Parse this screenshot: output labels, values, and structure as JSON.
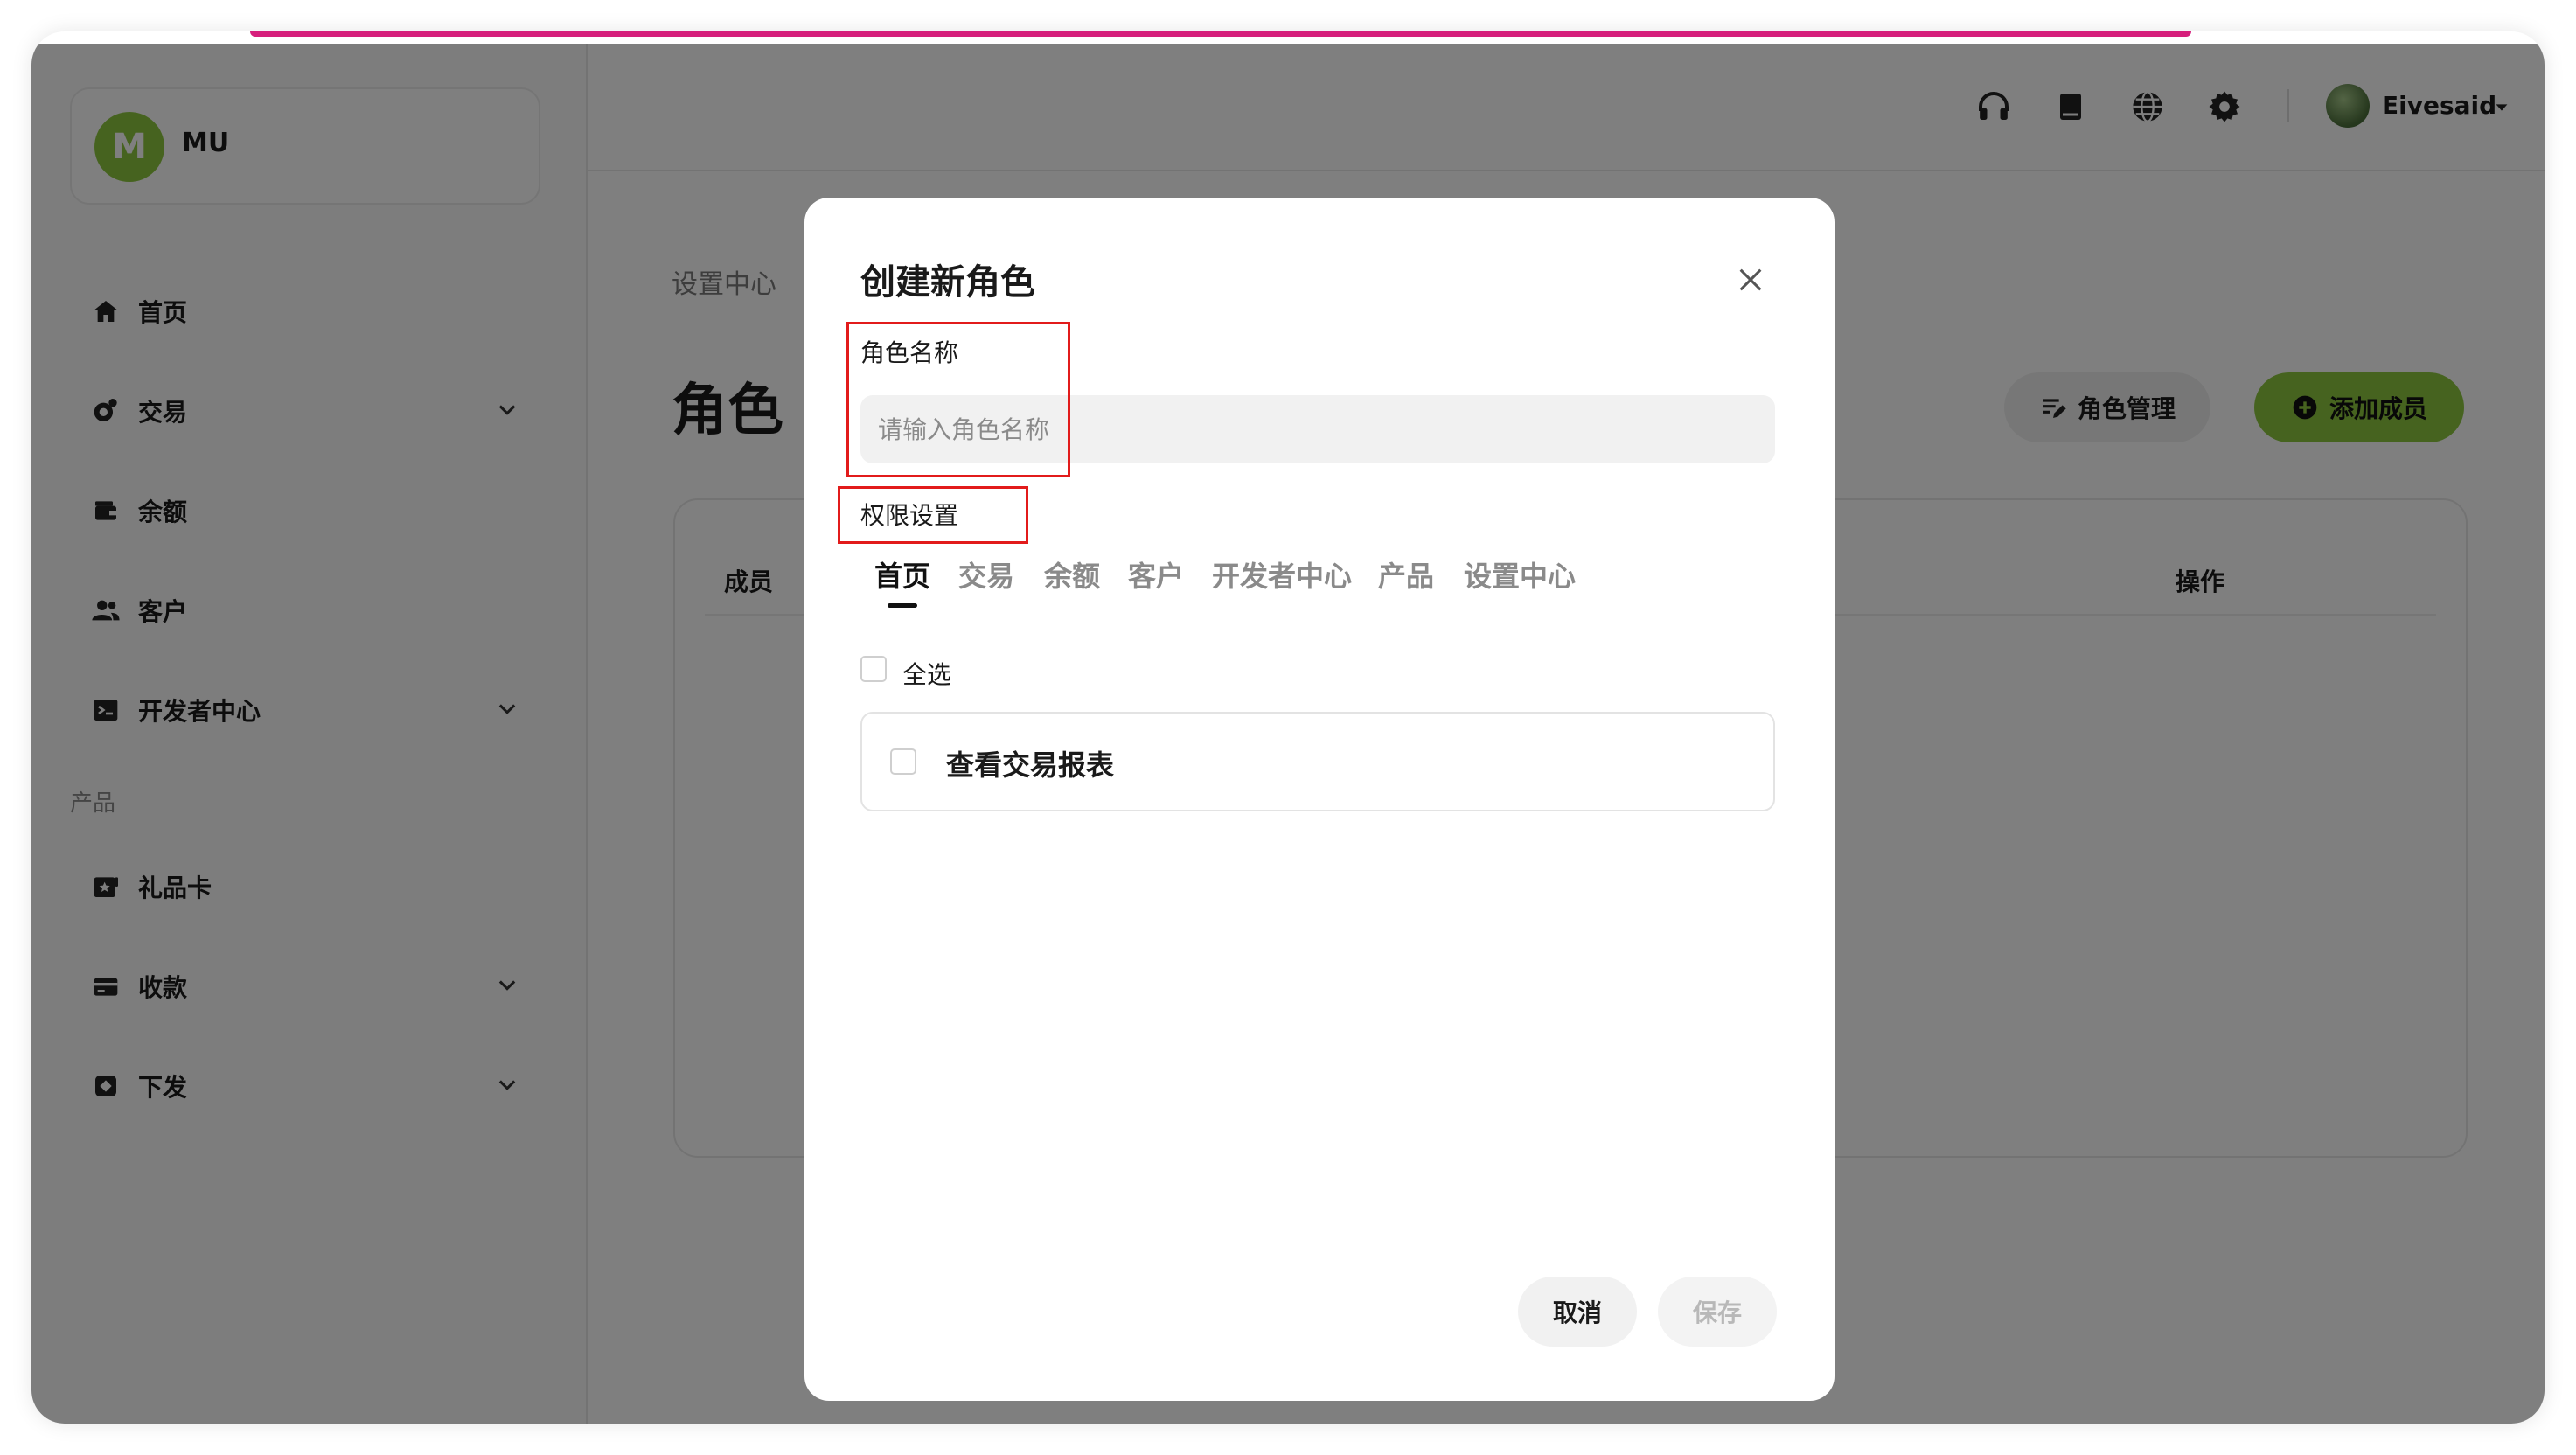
{
  "sidebar": {
    "org_initial": "M",
    "org_name": "MU",
    "items": [
      {
        "label": "首页"
      },
      {
        "label": "交易"
      },
      {
        "label": "余额"
      },
      {
        "label": "客户"
      },
      {
        "label": "开发者中心"
      },
      {
        "label": "礼品卡"
      },
      {
        "label": "收款"
      },
      {
        "label": "下发"
      }
    ],
    "section_products": "产品"
  },
  "header": {
    "user_name": "Eivesaid",
    "icons": [
      "headset-icon",
      "book-icon",
      "globe-icon",
      "gear-icon"
    ]
  },
  "page": {
    "breadcrumb": "设置中心",
    "title": "角色",
    "roles_button": "角色管理",
    "add_member_button": "添加成员",
    "table": {
      "col_member": "成员",
      "col_actions": "操作"
    }
  },
  "modal": {
    "title": "创建新角色",
    "role_name_label": "角色名称",
    "role_name_placeholder": "请输入角色名称",
    "role_name_value": "",
    "permissions_label": "权限设置",
    "tabs": [
      {
        "label": "首页"
      },
      {
        "label": "交易"
      },
      {
        "label": "余额"
      },
      {
        "label": "客户"
      },
      {
        "label": "开发者中心"
      },
      {
        "label": "产品"
      },
      {
        "label": "设置中心"
      }
    ],
    "active_tab": "首页",
    "select_all_label": "全选",
    "permissions": [
      {
        "label": "查看交易报表",
        "checked": false
      }
    ],
    "cancel_label": "取消",
    "save_label": "保存"
  },
  "colors": {
    "accent_green": "#8cc63f",
    "annotation_red": "#e21b1b",
    "top_accent": "#d61f7c"
  }
}
